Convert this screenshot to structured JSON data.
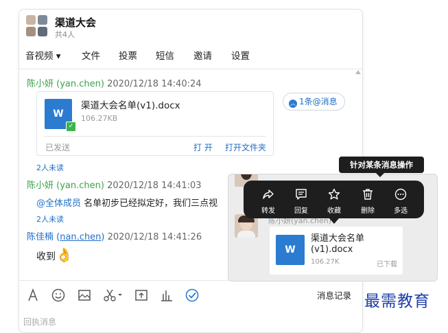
{
  "header": {
    "title": "渠道大会",
    "subtitle": "共4人"
  },
  "tabs": [
    "音视频 ▾",
    "文件",
    "投票",
    "短信",
    "邀请",
    "设置"
  ],
  "messages": {
    "m1": {
      "sender": "陈小妍 (yan.chen)",
      "time": "2020/12/18 14:40:24",
      "unread": "2人未读"
    },
    "file": {
      "name": "渠道大会名单(v1).docx",
      "size": "106.27KB",
      "status": "已发送",
      "open": "打 开",
      "open_folder": "打开文件夹",
      "icon": "W"
    },
    "mention_chip": "1条@消息",
    "m2": {
      "sender": "陈小妍 (yan.chen)",
      "time": "2020/12/18 14:41:03",
      "mention": "@全体成员",
      "text": " 名单初步已经拟定好，我们三点视",
      "unread": "2人未读"
    },
    "m3": {
      "sender_name": "陈佳楠 (",
      "sender_id": "nan.chen",
      "sender_close": ")",
      "time": "2020/12/18 14:41:26",
      "text": "收到",
      "emoji": "👌"
    }
  },
  "toolbar": {
    "history": "消息记录",
    "reply_placeholder": "回执消息"
  },
  "preview": {
    "name": "陈小妍(yan.chen)",
    "file_name": "渠道大会名单(v1).docx",
    "file_size": "106.27K",
    "file_status": "已下载",
    "icon": "W"
  },
  "context_menu": {
    "tooltip": "针对某条消息操作",
    "items": [
      {
        "label": "转发",
        "icon": "forward-icon"
      },
      {
        "label": "回复",
        "icon": "reply-icon"
      },
      {
        "label": "收藏",
        "icon": "star-icon"
      },
      {
        "label": "删除",
        "icon": "trash-icon"
      },
      {
        "label": "多选",
        "icon": "more-icon"
      }
    ]
  },
  "watermark": "最需教育",
  "colors": {
    "sender_green": "#3aa24a",
    "link_blue": "#1f6fc6",
    "doc_blue": "#2b7bd0",
    "menu_dark": "#1e1e1e"
  }
}
